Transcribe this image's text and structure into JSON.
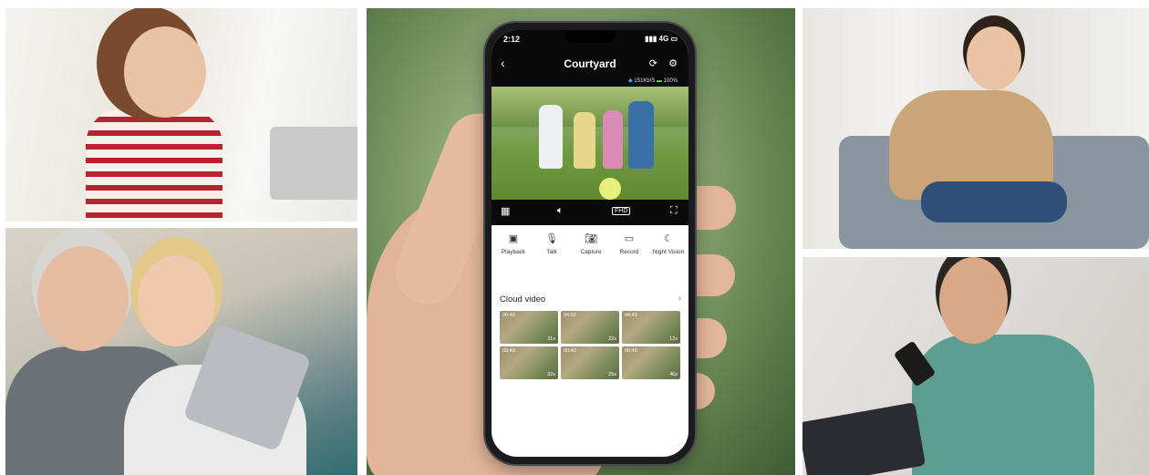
{
  "app": {
    "status_time": "2:12",
    "status_right": "4G",
    "screen_title": "Courtyard",
    "speed": "151Kb/S",
    "battery": "100%",
    "quality_label": "FHD"
  },
  "actions": [
    {
      "label": "Playback",
      "icon": "playback-icon"
    },
    {
      "label": "Talk",
      "icon": "microphone-icon"
    },
    {
      "label": "Capture",
      "icon": "camera-icon"
    },
    {
      "label": "Record",
      "icon": "video-record-icon"
    },
    {
      "label": "Night Vision",
      "icon": "moon-icon"
    }
  ],
  "cloud": {
    "title": "Cloud video",
    "clips": [
      {
        "time": "00:40",
        "duration": "31s"
      },
      {
        "time": "04:50",
        "duration": "22s"
      },
      {
        "time": "04:41",
        "duration": "12s"
      },
      {
        "time": "03:40",
        "duration": "32s"
      },
      {
        "time": "00:40",
        "duration": "25s"
      },
      {
        "time": "00:40",
        "duration": "46s"
      }
    ]
  }
}
